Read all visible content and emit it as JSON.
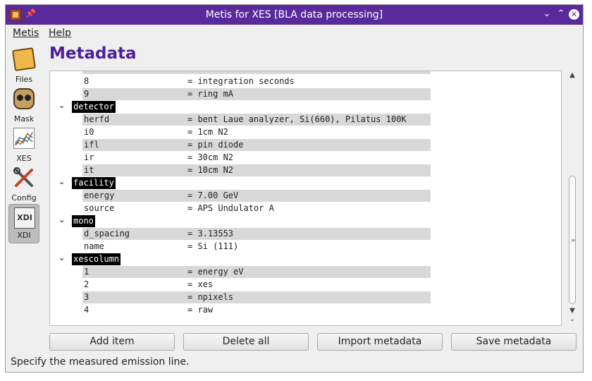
{
  "window": {
    "title": "Metis for XES [BLA data processing]",
    "pin_icon": "pin-icon",
    "controls": [
      "minimize-icon",
      "maximize-icon",
      "close-icon"
    ]
  },
  "menu": {
    "items": [
      "Metis",
      "Help"
    ]
  },
  "sidebar": {
    "items": [
      {
        "label": "Files",
        "icon": "folder-icon"
      },
      {
        "label": "Mask",
        "icon": "mask-icon"
      },
      {
        "label": "XES",
        "icon": "chart-icon"
      },
      {
        "label": "Config",
        "icon": "tools-icon"
      },
      {
        "label": "XDI",
        "icon": "xdi-icon",
        "active": true
      }
    ]
  },
  "page": {
    "heading": "Metadata"
  },
  "tree": {
    "rows": [
      {
        "type": "item",
        "key": "8",
        "value": "= integration seconds",
        "striped": false
      },
      {
        "type": "item",
        "key": "9",
        "value": "= ring mA",
        "striped": true
      },
      {
        "type": "group",
        "name": "detector"
      },
      {
        "type": "item",
        "key": "herfd",
        "value": "= bent Laue analyzer, Si(660), Pilatus 100K",
        "striped": true
      },
      {
        "type": "item",
        "key": "i0",
        "value": "= 1cm N2",
        "striped": false
      },
      {
        "type": "item",
        "key": "ifl",
        "value": "= pin diode",
        "striped": true
      },
      {
        "type": "item",
        "key": "ir",
        "value": "= 30cm N2",
        "striped": false
      },
      {
        "type": "item",
        "key": "it",
        "value": "= 10cm N2",
        "striped": true
      },
      {
        "type": "group",
        "name": "facility"
      },
      {
        "type": "item",
        "key": "energy",
        "value": "= 7.00 GeV",
        "striped": true
      },
      {
        "type": "item",
        "key": "source",
        "value": "= APS Undulator A",
        "striped": false
      },
      {
        "type": "group",
        "name": "mono"
      },
      {
        "type": "item",
        "key": "d_spacing",
        "value": "= 3.13553",
        "striped": true
      },
      {
        "type": "item",
        "key": "name",
        "value": "= Si (111)",
        "striped": false
      },
      {
        "type": "group",
        "name": "xescolumn"
      },
      {
        "type": "item",
        "key": "1",
        "value": "= energy eV",
        "striped": true
      },
      {
        "type": "item",
        "key": "2",
        "value": "= xes",
        "striped": false
      },
      {
        "type": "item",
        "key": "3",
        "value": "= npixels",
        "striped": true
      },
      {
        "type": "item",
        "key": "4",
        "value": "= raw",
        "striped": false
      }
    ]
  },
  "buttons": {
    "add": "Add item",
    "delete": "Delete all",
    "import": "Import metadata",
    "save": "Save metadata"
  },
  "status": {
    "text": "Specify the measured emission line."
  },
  "colors": {
    "titlebar": "#5a2a9c",
    "heading": "#4e1f9a",
    "stripe": "#d8d8d8",
    "group_bg": "#000000"
  }
}
